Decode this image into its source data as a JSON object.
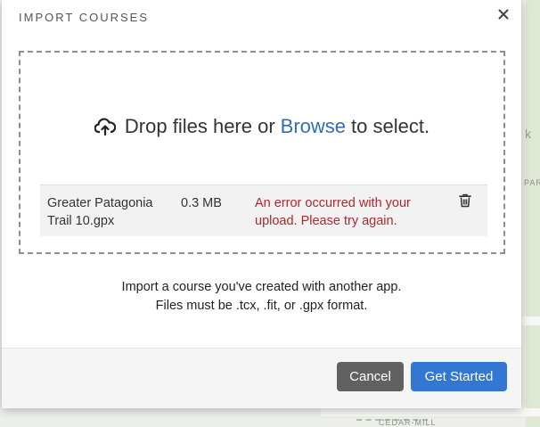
{
  "modal": {
    "title": "IMPORT COURSES",
    "close_icon": "close-icon"
  },
  "dropzone": {
    "icon": "cloud-upload-icon",
    "prompt_before": "Drop files here or",
    "browse_label": "Browse",
    "prompt_after": "to select."
  },
  "files": [
    {
      "name": "Greater Patagonia Trail 10.gpx",
      "size": "0.3 MB",
      "error": "An error occurred with your upload. Please try again.",
      "delete_icon": "trash-icon"
    }
  ],
  "info": {
    "line1": "Import a course you've created with another app.",
    "line2": "Files must be .tcx, .fit, or .gpx format."
  },
  "footer": {
    "cancel_label": "Cancel",
    "start_label": "Get Started"
  },
  "map": {
    "labels": [
      "k",
      "PARK",
      "CEDAR-MILL"
    ]
  },
  "colors": {
    "link": "#2f6fb5",
    "error": "#b3262d",
    "primary_button": "#3278d2",
    "secondary_button": "#616161"
  }
}
